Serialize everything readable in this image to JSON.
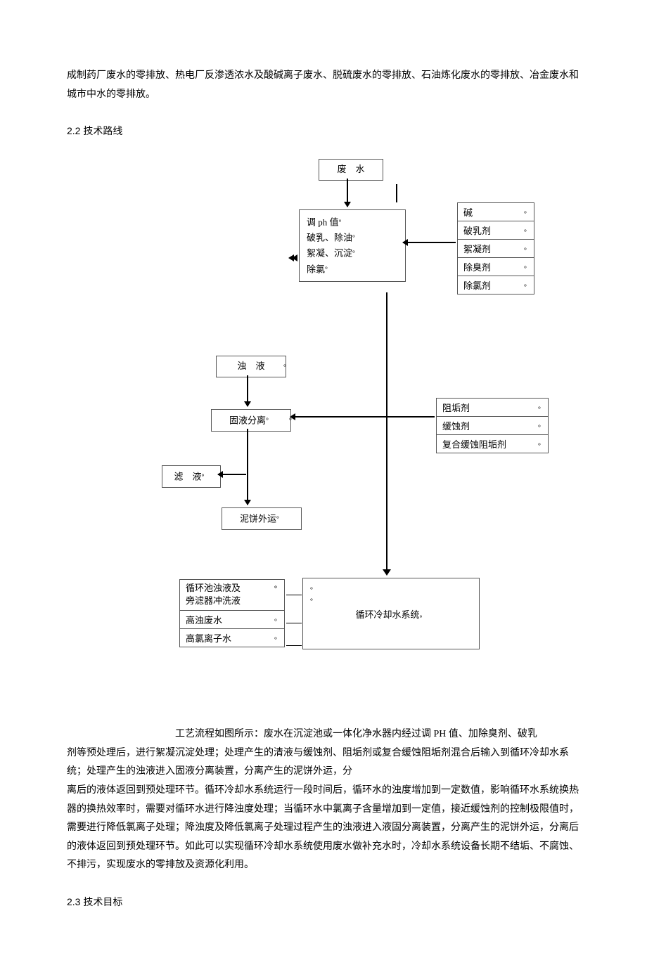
{
  "intro": "成制药厂废水的零排放、热电厂反渗透浓水及酸碱离子废水、脱硫废水的零排放、石油炼化废水的零排放、冶金废水和城市中水的零排放。",
  "sec22": "2.2  技术路线",
  "sec23": "2.3  技术目标",
  "nodes": {
    "wastewater": "废　水",
    "pretreat_l1": "调 ph 值",
    "pretreat_l2": "破乳、除油",
    "pretreat_l3": "絮凝、沉淀",
    "pretreat_l4": "除氯",
    "chem1": "碱",
    "chem2": "破乳剂",
    "chem3": "絮凝剂",
    "chem4": "除臭剂",
    "chem5": "除氯剂",
    "turbid": "浊　液",
    "solidliq": "固液分离",
    "filtrate": "滤　液",
    "cake": "泥饼外运",
    "inh1": "阻垢剂",
    "inh2": "缓蚀剂",
    "inh3": "复合缓蚀阻垢剂",
    "feed1_a": "循环池浊液及",
    "feed1_b": "旁滤器冲洗液",
    "feed2": "高浊废水",
    "feed3": "高氯离子水",
    "cooling": "循环冷却水系统"
  },
  "desc1": "工艺流程如图所示：废水在沉淀池或一体化净水器内经过调 PH 值、加除臭剂、破乳",
  "desc2": "剂等预处理后，进行絮凝沉淀处理；处理产生的清液与缓蚀剂、阻垢剂或复合缓蚀阻垢剂混合后输入到循环冷却水系统；处理产生的浊液进入固液分离装置，分离产生的泥饼外运，分",
  "desc3": "离后的液体返回到预处理环节。循环冷却水系统运行一段时间后，循环水的浊度增加到一定数值，影响循环水系统换热器的换热效率时，需要对循环水进行降浊度处理；当循环水中氯离子含量增加到一定值，接近缓蚀剂的控制极限值时，需要进行降低氯离子处理；降浊度及降低氯离子处理过程产生的浊液进入液固分离装置，分离产生的泥饼外运，分离后的液体返回到预处理环节。如此可以实现循环冷却水系统使用废水做补充水时，冷却水系统设备长期不结垢、不腐蚀、不排污，实现废水的零排放及资源化利用。",
  "chart_data": {
    "type": "diagram",
    "title": "技术路线工艺流程",
    "nodes": [
      {
        "id": "wastewater",
        "label": "废水"
      },
      {
        "id": "pretreat",
        "label": "调ph值/破乳除油/絮凝沉淀/除氯"
      },
      {
        "id": "chems",
        "label": [
          "碱",
          "破乳剂",
          "絮凝剂",
          "除臭剂",
          "除氯剂"
        ]
      },
      {
        "id": "turbid",
        "label": "浊液"
      },
      {
        "id": "solidliq",
        "label": "固液分离"
      },
      {
        "id": "filtrate",
        "label": "滤液"
      },
      {
        "id": "cake",
        "label": "泥饼外运"
      },
      {
        "id": "inhibitors",
        "label": [
          "阻垢剂",
          "缓蚀剂",
          "复合缓蚀阻垢剂"
        ]
      },
      {
        "id": "cooling",
        "label": "循环冷却水系统"
      },
      {
        "id": "feeds",
        "label": [
          "循环池浊液及旁滤器冲洗液",
          "高浊废水",
          "高氯离子水"
        ]
      }
    ],
    "edges": [
      [
        "wastewater",
        "pretreat"
      ],
      [
        "chems",
        "pretreat"
      ],
      [
        "pretreat",
        "turbid"
      ],
      [
        "turbid",
        "solidliq"
      ],
      [
        "solidliq",
        "filtrate"
      ],
      [
        "solidliq",
        "cake"
      ],
      [
        "inhibitors",
        "cooling"
      ],
      [
        "feeds",
        "cooling"
      ],
      [
        "pretreat",
        "cooling"
      ]
    ]
  }
}
